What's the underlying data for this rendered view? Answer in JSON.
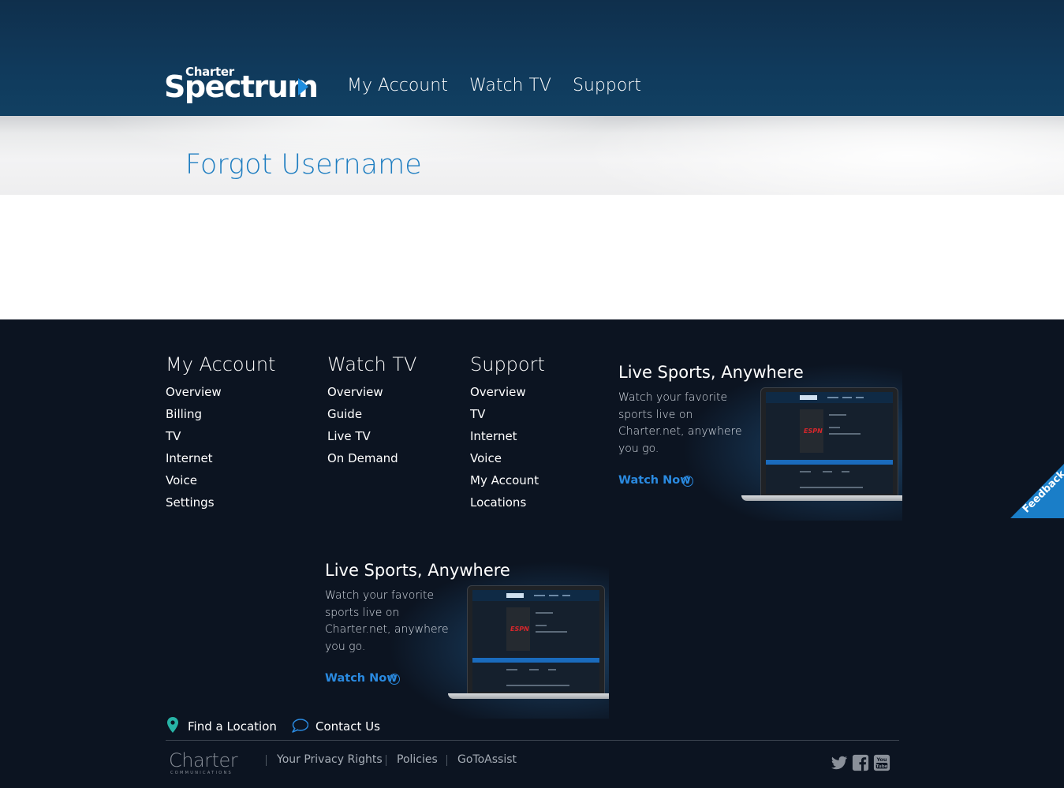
{
  "header": {
    "logo_top": "Charter",
    "logo_main": "Spectrum",
    "nav": [
      "My Account",
      "Watch TV",
      "Support"
    ]
  },
  "page": {
    "title": "Forgot Username"
  },
  "footer": {
    "columns": [
      {
        "heading": "My Account",
        "links": [
          "Overview",
          "Billing",
          "TV",
          "Internet",
          "Voice",
          "Settings"
        ]
      },
      {
        "heading": "Watch TV",
        "links": [
          "Overview",
          "Guide",
          "Live TV",
          "On Demand"
        ]
      },
      {
        "heading": "Support",
        "links": [
          "Overview",
          "TV",
          "Internet",
          "Voice",
          "My Account",
          "Locations"
        ]
      }
    ],
    "promos": [
      {
        "title": "Live Sports, Anywhere",
        "text": "Watch your favorite sports live on Charter.net, anywhere you go.",
        "button": "Watch Now"
      },
      {
        "title": "Live Sports, Anywhere",
        "text": "Watch your favorite sports live on Charter.net, anywhere you go.",
        "button": "Watch Now"
      }
    ],
    "feedback": "Feedback",
    "utility": {
      "find_location": "Find a Location",
      "contact_us": "Contact Us"
    },
    "charter_logo": {
      "main": "Charter",
      "sub": "COMMUNICATIONS"
    },
    "legal": [
      "Your Privacy Rights",
      "Policies",
      "GoToAssist"
    ],
    "laptop_screen": {
      "espn": "ESPN"
    },
    "social_icons": [
      "twitter-icon",
      "facebook-icon",
      "youtube-icon"
    ],
    "colors": {
      "header": "#103a5c",
      "footer": "#0c1421",
      "accent": "#1f7ec1",
      "link_blue": "#2a8ae0"
    }
  }
}
